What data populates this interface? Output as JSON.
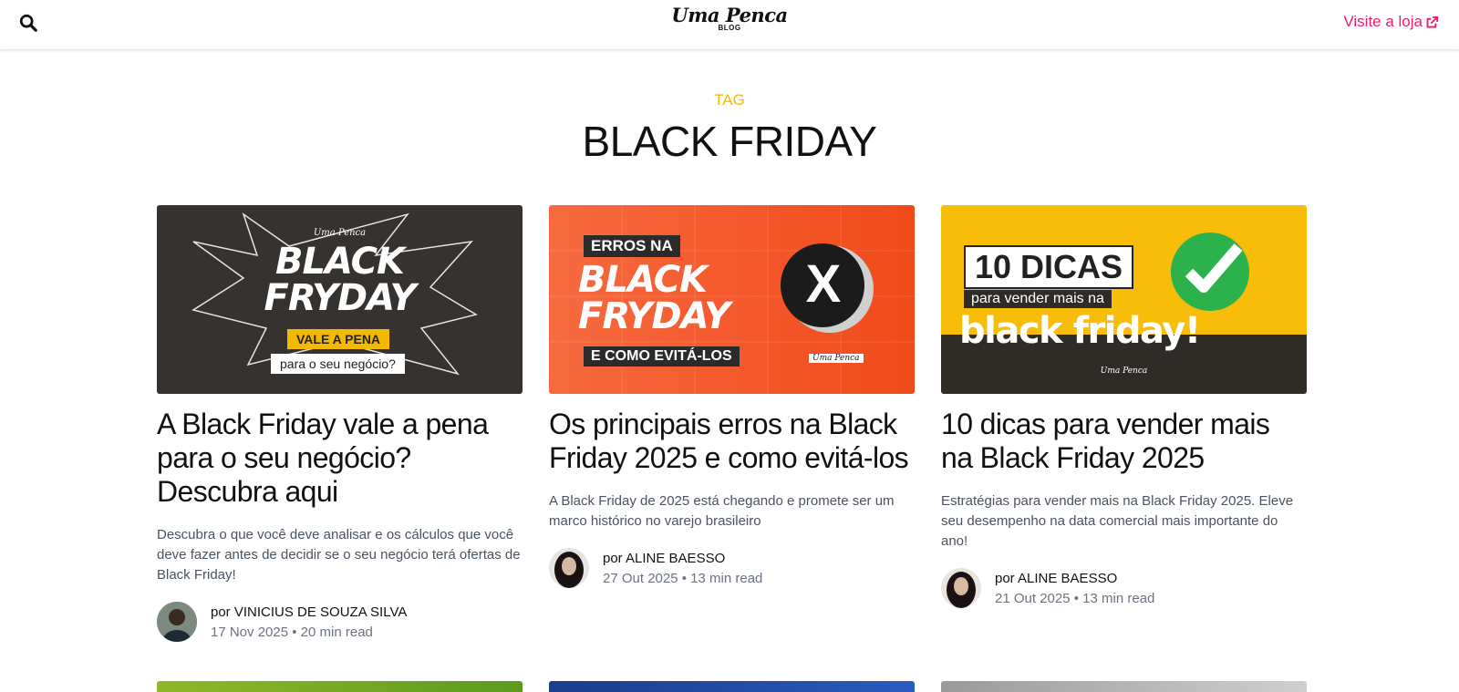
{
  "header": {
    "logo": "Uma Penca",
    "logo_sub": "BLOG",
    "store_link": "Visite a loja",
    "icons": {
      "search": "search-icon",
      "external": "external-link-icon"
    },
    "accent_color": "#ea1d6f"
  },
  "tag": {
    "label": "TAG",
    "title": "BLACK FRIDAY",
    "label_color": "#f5b800"
  },
  "cards": [
    {
      "image": {
        "brand": "Uma Penca",
        "line1": "BLACK",
        "line2": "FRYDAY",
        "badge": "VALE A PENA",
        "caption": "para o seu negócio?"
      },
      "title": "A Black Friday vale a pena para o seu negócio? Descubra aqui",
      "excerpt": "Descubra o que você deve analisar e os cálculos que você deve fazer antes de decidir se o seu negócio terá ofertas de Black Friday!",
      "author_prefix": "por",
      "author": "VINICIUS DE SOUZA SILVA",
      "date": "17 Nov 2025",
      "read_time": "20 min read"
    },
    {
      "image": {
        "top": "ERROS NA",
        "line1": "BLACK",
        "line2": "FRYDAY",
        "bottom": "E COMO EVITÁ-LOS",
        "mark": "X",
        "brand": "Uma Penca"
      },
      "title": "Os principais erros na Black Friday 2025 e como evitá-los",
      "excerpt": "A Black Friday de 2025 está chegando e promete ser um marco histórico no varejo brasileiro",
      "author_prefix": "por",
      "author": "ALINE BAESSO",
      "date": "27 Out 2025",
      "read_time": "13 min read"
    },
    {
      "image": {
        "box": "10 DICAS",
        "sub": "para vender mais na",
        "big": "black friday!",
        "brand": "Uma Penca"
      },
      "title": "10 dicas para vender mais na Black Friday 2025",
      "excerpt": "Estratégias para vender mais na Black Friday 2025. Eleve seu desempenho na data comercial mais importante do ano!",
      "author_prefix": "por",
      "author": "ALINE BAESSO",
      "date": "21 Out 2025",
      "read_time": "13 min read"
    }
  ]
}
